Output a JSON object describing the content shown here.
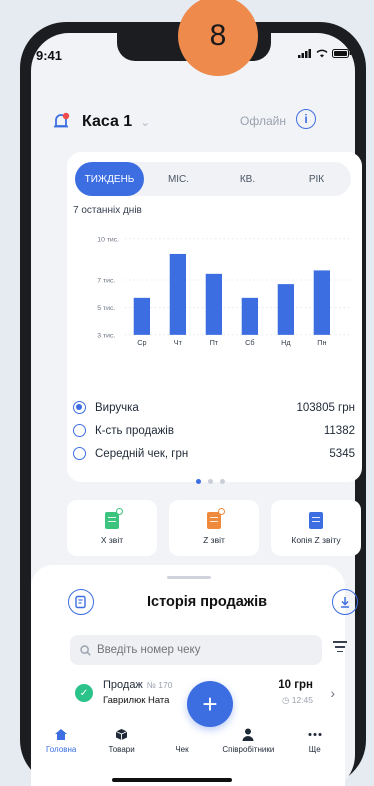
{
  "step_badge": "8",
  "status": {
    "time": "9:41"
  },
  "header": {
    "register": "Каса 1",
    "offline": "Офлайн"
  },
  "period_tabs": [
    "ТИЖДЕНЬ",
    "МІС.",
    "КВ.",
    "РІК"
  ],
  "range_label": "7 останніх днів",
  "chart_data": {
    "type": "bar",
    "categories": [
      "Ср",
      "Чт",
      "Пт",
      "Сб",
      "Нд",
      "Пн"
    ],
    "values": [
      5700,
      8900,
      7450,
      5700,
      6700,
      7700
    ],
    "ylim": [
      3000,
      10000
    ],
    "y_ticks": [
      {
        "value": 10000,
        "label": "10 тис."
      },
      {
        "value": 7000,
        "label": "7 тис."
      },
      {
        "value": 5000,
        "label": "5 тис."
      },
      {
        "value": 3000,
        "label": "3 тис."
      }
    ],
    "title": "",
    "xlabel": "",
    "ylabel": "",
    "color": "#3c6ee2"
  },
  "metrics": [
    {
      "label": "Виручка",
      "value": "103805 грн",
      "selected": true
    },
    {
      "label": "К-сть продажів",
      "value": "11382",
      "selected": false
    },
    {
      "label": "Середній чек, грн",
      "value": "5345",
      "selected": false
    }
  ],
  "reports": [
    {
      "label": "X звіт",
      "color": "#3cc47e"
    },
    {
      "label": "Z звіт",
      "color": "#ef8a3c"
    },
    {
      "label": "Копія Z звіту",
      "color": "#3c6ee2"
    }
  ],
  "history": {
    "title": "Історія продажів",
    "search_placeholder": "Введіть номер чеку"
  },
  "sale": {
    "title": "Продаж",
    "number": "№ 170",
    "person": "Гаврилюк Ната",
    "amount": "10 грн",
    "time": "12:45"
  },
  "tabbar": [
    "Головна",
    "Товари",
    "Чек",
    "Співробітники",
    "Ще"
  ],
  "colors": {
    "accent": "#3c6ee2",
    "badge": "#ef8a4d",
    "success": "#2cc38b"
  }
}
